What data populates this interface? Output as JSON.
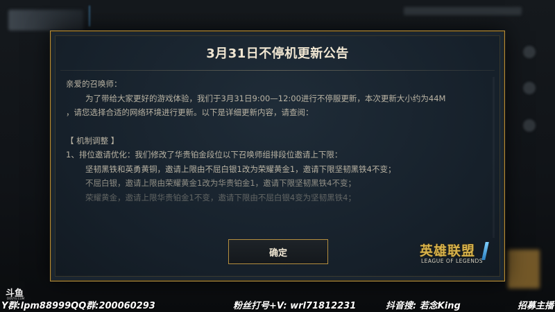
{
  "modal": {
    "title": "3月31日不停机更新公告",
    "greeting": "亲爱的召唤师：",
    "intro_line1": "为了带给大家更好的游戏体验，我们于3月31日9:00—12:00进行不停服更新，本次更新大小约为44M",
    "intro_line2": "，请您选择合适的网络环境进行更新。以下是详细更新内容，请查阅：",
    "section_heading": "【 机制调整 】",
    "item1": "1、排位邀请优化：我们修改了华贵铂金段位以下召唤师组排段位邀请上下限：",
    "item1_sub1": "坚韧黑铁和英勇黄铜，邀请上限由不屈白银1改为荣耀黄金1，邀请下限坚韧黑铁4不变；",
    "item1_sub2": "不屈白银，邀请上限由荣耀黄金1改为华贵铂金1，邀请下限坚韧黑铁4不变；",
    "item1_sub3": "荣耀黄金，邀请上限华贵铂金1不变，邀请下限由不屈白银4变为坚韧黑铁4；",
    "confirm_label": "确定",
    "logo_cn": "英雄联盟",
    "logo_en": "LEAGUE OF LEGENDS"
  },
  "overlay": {
    "platform": "斗鱼",
    "platform_sub": "DOUYU.COM",
    "ticker_group": "Y群:lpm88999QQ群:200060293",
    "ticker_fans": "粉丝打号+V: wrl71812231",
    "ticker_douyin": "抖音搜: 若念King",
    "ticker_recruit": "招募主播"
  },
  "colors": {
    "accent_gold": "#b58f3f",
    "title_text": "#f0e6d2",
    "body_text": "#b9b3a3",
    "panel_bg": "#1a2530"
  }
}
